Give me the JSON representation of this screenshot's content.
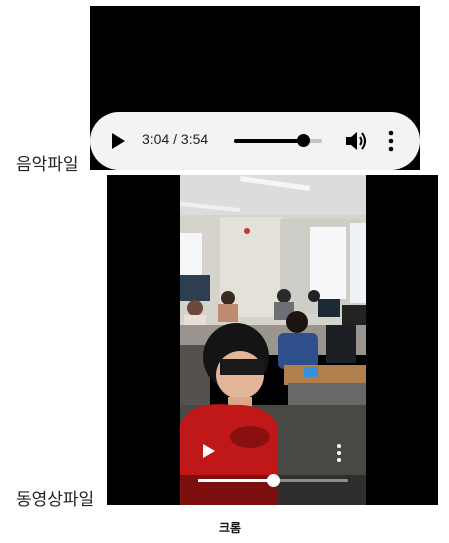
{
  "audio": {
    "label": "음악파일",
    "current_time": "3:04",
    "separator": "/",
    "duration": "3:54",
    "progress": 0.786
  },
  "video": {
    "label": "동영상파일",
    "progress": 0.5
  },
  "caption": "크롬",
  "colors": {
    "player_bar": "#f1f3f4",
    "media_background": "#000000"
  },
  "icons": [
    "play-icon",
    "volume-icon",
    "more-options-icon"
  ]
}
